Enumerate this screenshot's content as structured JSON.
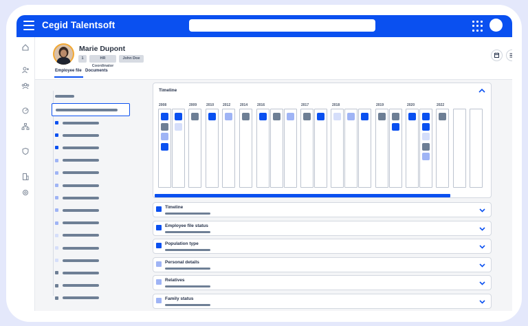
{
  "app": {
    "title": "Cegid Talentsoft",
    "colors": {
      "brand": "#0a50f0",
      "bullet_dark": "#0a50f0",
      "bullet_grey": "#6e7f95",
      "bullet_light": "#9fb4f5",
      "bullet_pale": "#d5defa"
    }
  },
  "topbar": {
    "menu_icon": "hamburger-icon",
    "search_icon": "search-bar",
    "apps_icon": "grid-icon",
    "avatar_icon": "user-avatar"
  },
  "sidenav": {
    "icons": [
      "home-icon",
      "add-user-icon",
      "team-icon",
      "dashboard-icon",
      "org-chart-icon",
      "shield-icon",
      "building-icon",
      "settings-icon"
    ]
  },
  "profile": {
    "name": "Marie Dupont",
    "tags": [
      "1",
      "HR Coordinator",
      "John Doe"
    ],
    "tabs": [
      "Employee file",
      "Documents"
    ],
    "actions": [
      "calendar-icon",
      "list-icon"
    ]
  },
  "timeline": {
    "title": "Timeline",
    "years": [
      "2008",
      "2009",
      "2010",
      "2012",
      "2014",
      "2016",
      "2017",
      "2018",
      "2019",
      "2020",
      "2022"
    ],
    "columns": [
      [
        "dark",
        "grey",
        "light",
        "dark"
      ],
      [
        "dark",
        "pale"
      ],
      [
        "grey"
      ],
      [
        "dark"
      ],
      [
        "light"
      ],
      [
        "grey"
      ],
      [
        "dark"
      ],
      [
        "grey"
      ],
      [
        "light"
      ],
      [
        "grey"
      ],
      [
        "dark"
      ],
      [
        "pale"
      ],
      [
        "light"
      ],
      [
        "dark"
      ],
      [
        "grey"
      ],
      [
        "grey",
        "dark"
      ],
      [
        "dark"
      ],
      [
        "dark",
        "dark",
        "pale",
        "grey",
        "light"
      ],
      [
        "grey"
      ],
      [],
      []
    ]
  },
  "sections": [
    {
      "title": "Timeline",
      "icon": "dark"
    },
    {
      "title": "Employee file status",
      "icon": "dark"
    },
    {
      "title": "Population type",
      "icon": "dark"
    },
    {
      "title": "Personal details",
      "icon": "light"
    },
    {
      "title": "Relatives",
      "icon": "light"
    },
    {
      "title": "Family status",
      "icon": "light"
    }
  ],
  "leftlist": {
    "bullets": [
      "dark",
      "dark",
      "dark",
      "light",
      "light",
      "light",
      "light",
      "light",
      "light",
      "pale",
      "pale",
      "pale",
      "grey",
      "grey",
      "grey"
    ]
  }
}
